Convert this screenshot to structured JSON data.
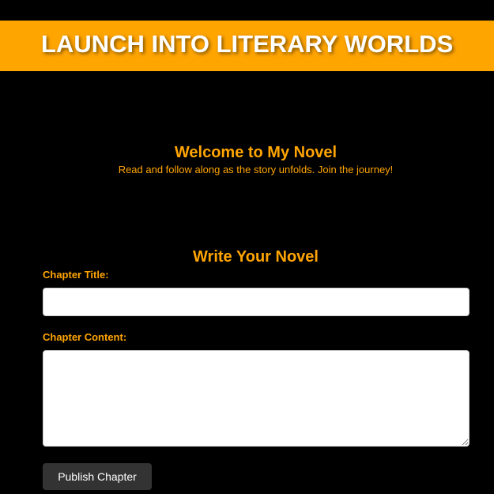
{
  "header": {
    "title": "LAUNCH INTO LITERARY WORLDS"
  },
  "welcome": {
    "title": "Welcome to My Novel",
    "subtitle": "Read and follow along as the story unfolds. Join the journey!"
  },
  "form": {
    "title": "Write Your Novel",
    "chapter_title_label": "Chapter Title:",
    "chapter_title_value": "",
    "chapter_content_label": "Chapter Content:",
    "chapter_content_value": "",
    "publish_label": "Publish Chapter"
  },
  "colors": {
    "accent": "#ffa500",
    "background": "#000000",
    "button": "#333333",
    "text_light": "#ffffff"
  }
}
